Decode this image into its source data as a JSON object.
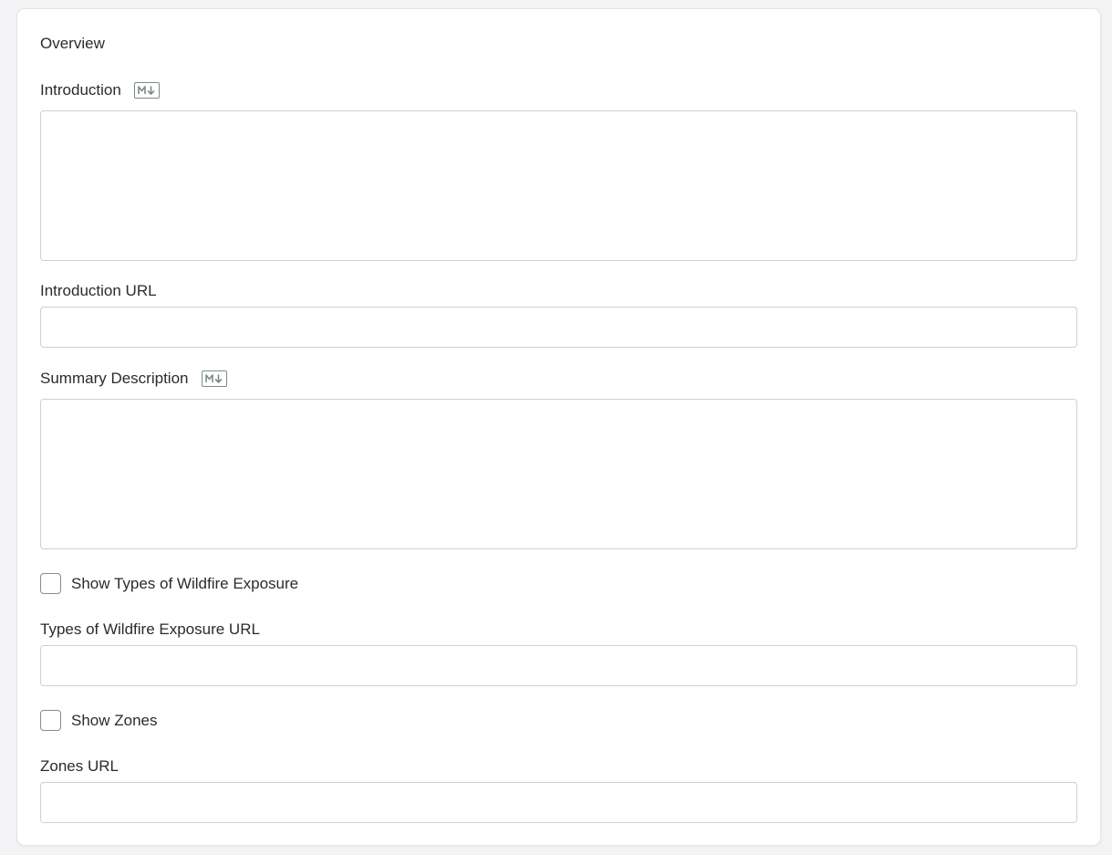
{
  "overview": {
    "section_title": "Overview",
    "introduction": {
      "label": "Introduction",
      "markdown_icon": "markdown-icon",
      "value": ""
    },
    "introduction_url": {
      "label": "Introduction URL",
      "value": ""
    },
    "summary_description": {
      "label": "Summary Description",
      "markdown_icon": "markdown-icon",
      "value": ""
    },
    "show_types_of_wildfire_exposure": {
      "label": "Show Types of Wildfire Exposure",
      "checked": false
    },
    "types_of_wildfire_exposure_url": {
      "label": "Types of Wildfire Exposure URL",
      "value": ""
    },
    "show_zones": {
      "label": "Show Zones",
      "checked": false
    },
    "zones_url": {
      "label": "Zones URL",
      "value": ""
    }
  },
  "colors": {
    "page_background": "#f3f3f5",
    "card_background": "#ffffff",
    "field_border": "#cfcfd3",
    "text": "#2b2b2b",
    "markdown_badge": "#7d8a8a"
  }
}
